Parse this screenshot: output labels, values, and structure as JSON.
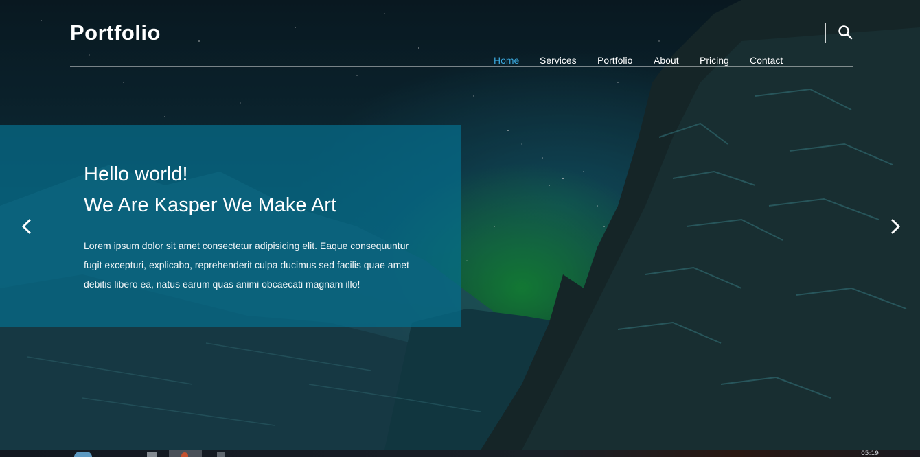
{
  "header": {
    "logo": "Portfolio",
    "nav": [
      {
        "label": "Home",
        "active": true
      },
      {
        "label": "Services",
        "active": false
      },
      {
        "label": "Portfolio",
        "active": false
      },
      {
        "label": "About",
        "active": false
      },
      {
        "label": "Pricing",
        "active": false
      },
      {
        "label": "Contact",
        "active": false
      }
    ],
    "search_icon": "search-icon"
  },
  "slide": {
    "heading_line1": "Hello world!",
    "heading_line2": "We Are Kasper We Make Art",
    "body": "Lorem ipsum dolor sit amet consectetur adipisicing elit. Eaque consequuntur fugit excepturi, explicabo, reprehenderit culpa ducimus sed facilis quae amet debitis libero ea, natus earum quas animi obcaecati magnam illo!",
    "prev_icon": "chevron-left-icon",
    "next_icon": "chevron-right-icon"
  },
  "taskbar": {
    "clock": "05:19"
  },
  "colors": {
    "accent": "#3aa7dc",
    "panel": "#066e8c",
    "text": "#ffffff"
  }
}
